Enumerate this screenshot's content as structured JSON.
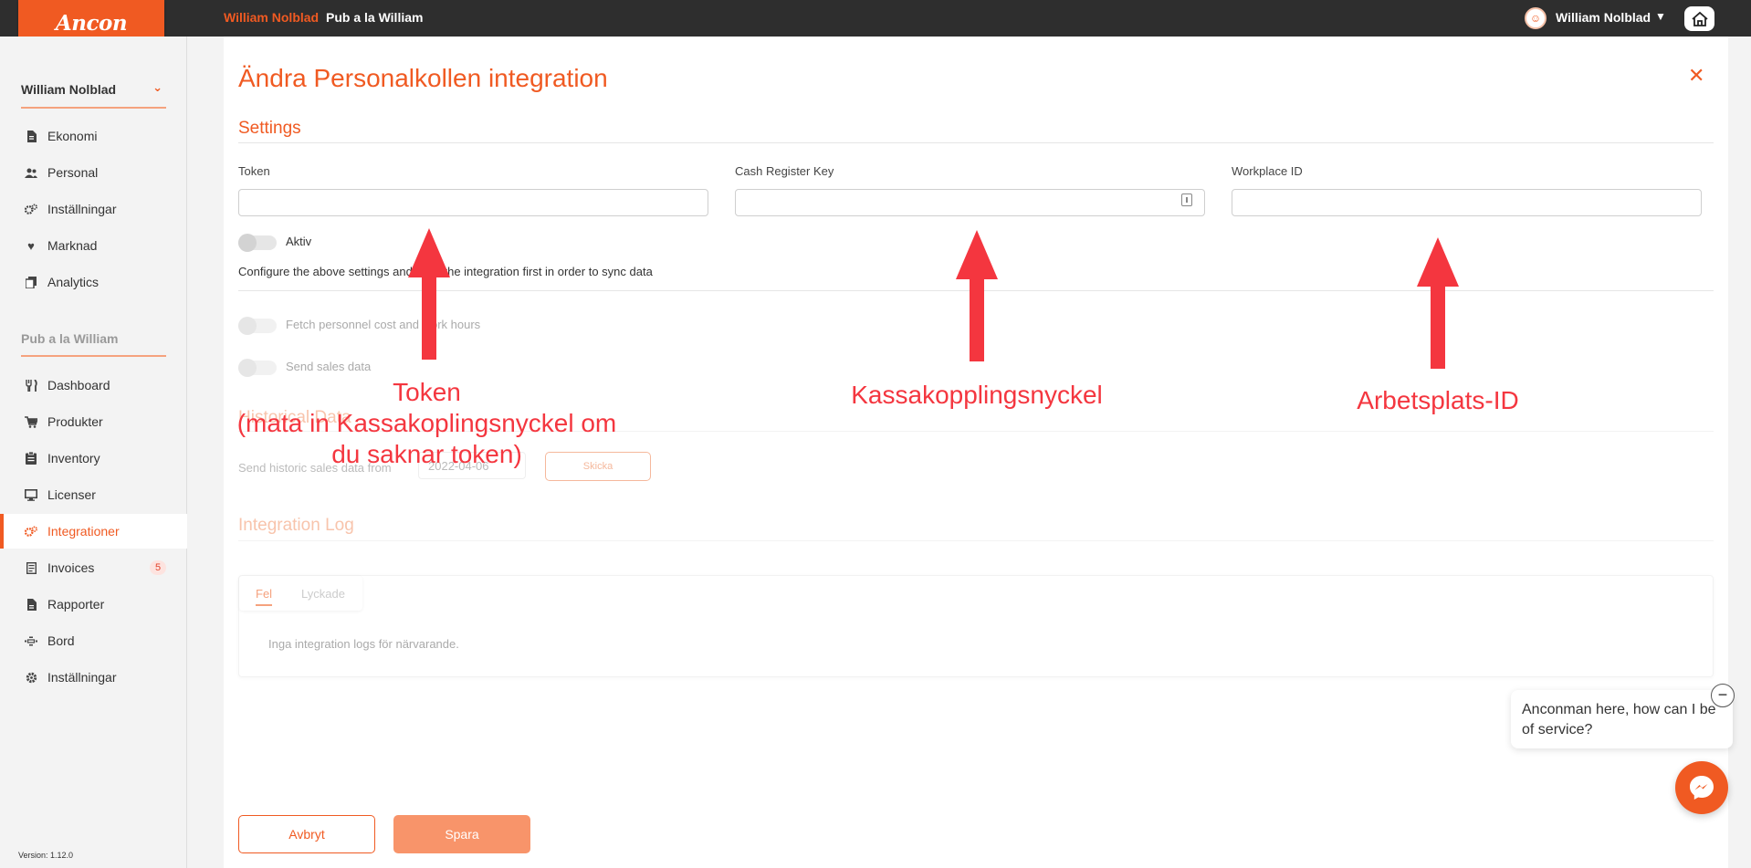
{
  "header": {
    "logo_text": "Ancon",
    "crumb_user": "William Nolblad",
    "crumb_venue": "Pub a la William",
    "username": "William Nolblad"
  },
  "sidebar": {
    "user_section": "William Nolblad",
    "user_items": [
      {
        "label": "Ekonomi",
        "icon": "document-icon"
      },
      {
        "label": "Personal",
        "icon": "people-icon"
      },
      {
        "label": "Inställningar",
        "icon": "gears-icon"
      },
      {
        "label": "Marknad",
        "icon": "heart-icon"
      },
      {
        "label": "Analytics",
        "icon": "copy-icon"
      }
    ],
    "venue_section": "Pub a la William",
    "venue_items": [
      {
        "label": "Dashboard",
        "icon": "cutlery-icon"
      },
      {
        "label": "Produkter",
        "icon": "cart-icon"
      },
      {
        "label": "Inventory",
        "icon": "clipboard-icon"
      },
      {
        "label": "Licenser",
        "icon": "monitor-icon"
      },
      {
        "label": "Integrationer",
        "icon": "gears-icon",
        "active": true
      },
      {
        "label": "Invoices",
        "icon": "invoice-icon",
        "badge": "5"
      },
      {
        "label": "Rapporter",
        "icon": "report-icon"
      },
      {
        "label": "Bord",
        "icon": "table-icon"
      },
      {
        "label": "Inställningar",
        "icon": "gear-icon"
      }
    ],
    "version": "Version: 1.12.0"
  },
  "form": {
    "title": "Ändra Personalkollen integration",
    "settings_heading": "Settings",
    "token_label": "Token",
    "token_value": "",
    "cash_key_label": "Cash Register Key",
    "cash_key_value": "",
    "workplace_label": "Workplace ID",
    "workplace_value": "",
    "active_label": "Aktiv",
    "info_text": "Configure the above settings and save the integration first in order to sync data",
    "fetch_label": "Fetch personnel cost and work hours",
    "send_sales_label": "Send sales data",
    "historical_heading": "Historical Data",
    "historic_row_label": "Send historic sales data from",
    "historic_date": "2022-04-06",
    "send_button": "Skicka",
    "log_heading": "Integration Log",
    "tab_errors": "Fel",
    "tab_success": "Lyckade",
    "log_empty": "Inga integration logs för närvarande.",
    "cancel_button": "Avbryt",
    "save_button": "Spara"
  },
  "annotations": {
    "token_line1": "Token",
    "token_line2": "(mata in Kassakoplingsnyckel om",
    "token_line3": "du saknar token)",
    "cash_key": "Kassakopplingsnyckel",
    "workplace": "Arbetsplats-ID",
    "color": "#f4363f"
  },
  "chat": {
    "message": "Anconman here, how can I be of service?"
  },
  "colors": {
    "accent": "#f05a22",
    "topbar": "#2e2e2e",
    "save_button": "#f8946a"
  }
}
